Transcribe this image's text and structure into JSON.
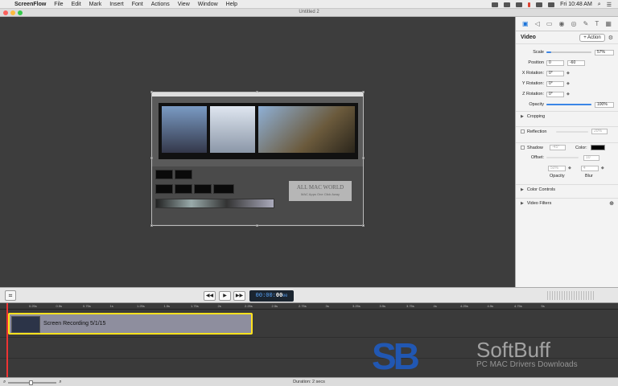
{
  "menubar": {
    "app_name": "ScreenFlow",
    "items": [
      "File",
      "Edit",
      "Mark",
      "Insert",
      "Font",
      "Actions",
      "View",
      "Window",
      "Help"
    ],
    "clock": "Fri 10:48 AM"
  },
  "window": {
    "title": "Untitled 2"
  },
  "preview": {
    "watermark_title": "ALL MAC WORLD",
    "watermark_sub": "MAC Apps One Click Away"
  },
  "inspector": {
    "section_title": "Video",
    "action_label": "+ Action",
    "scale": {
      "label": "Scale",
      "value": "57%",
      "fraction": 0.57
    },
    "position": {
      "label": "Position",
      "x": "0",
      "y": "-60"
    },
    "x_rotation": {
      "label": "X Rotation:",
      "value": "0°"
    },
    "y_rotation": {
      "label": "Y Rotation:",
      "value": "0°"
    },
    "z_rotation": {
      "label": "Z Rotation:",
      "value": "0°"
    },
    "opacity": {
      "label": "Opacity",
      "value": "100%",
      "fraction": 1.0
    },
    "cropping": "Cropping",
    "reflection": {
      "label": "Reflection",
      "value": "20%"
    },
    "shadow": {
      "label": "Shadow",
      "angle": "-45°",
      "color_label": "Color:"
    },
    "offset": {
      "label": "Offset:",
      "value": "10"
    },
    "opacity_field": {
      "label": "Opacity",
      "value": "50%"
    },
    "blur": {
      "label": "Blur",
      "value": "4"
    },
    "color_controls": "Color Controls",
    "video_filters": "Video Filters"
  },
  "transport": {
    "timecode_prefix": "00:00:",
    "timecode_suffix": "00",
    "timecode_frame": "00"
  },
  "ruler": {
    "ticks": [
      "0.25s",
      "0.5s",
      "0.75s",
      "1s",
      "1.25s",
      "1.5s",
      "1.75s",
      "2s",
      "2.25s",
      "2.5s",
      "2.75s",
      "3s",
      "3.25s",
      "3.5s",
      "3.75s",
      "4s",
      "4.25s",
      "4.5s",
      "4.75s",
      "5s"
    ]
  },
  "timeline": {
    "clip_name": "Screen Recording 5/1/15",
    "duration": "Duration: 2 secs"
  },
  "overlay": {
    "logo": "SB",
    "brand": "SoftBuff",
    "tagline": "PC MAC Drivers Downloads"
  },
  "colors": {
    "accent": "#3b86e6",
    "clip_border": "#ffe21e",
    "playhead": "#e33333"
  }
}
